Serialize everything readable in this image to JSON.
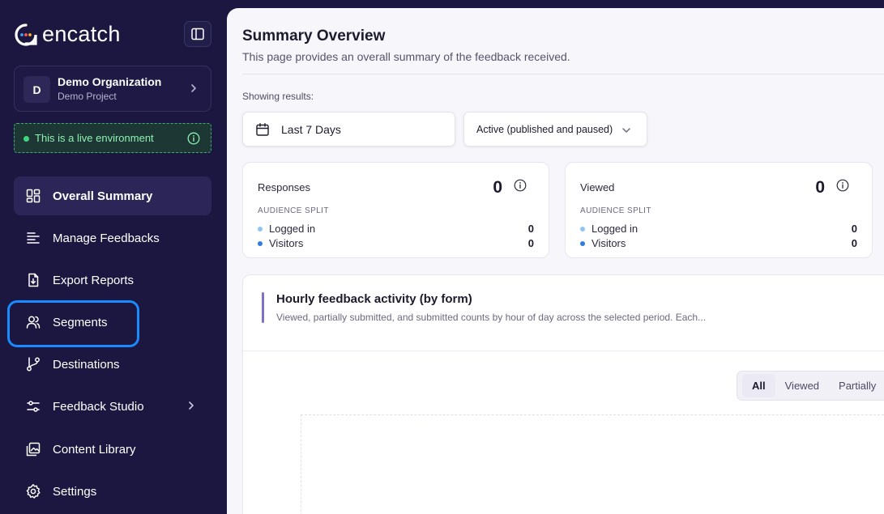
{
  "sidebar": {
    "brand": "encatch",
    "org": {
      "avatar": "D",
      "name": "Demo Organization",
      "project": "Demo Project"
    },
    "live_env": "This is a live environment",
    "nav": [
      {
        "label": "Overall Summary",
        "icon": "dashboard-icon",
        "active": true
      },
      {
        "label": "Manage Feedbacks",
        "icon": "list-icon"
      },
      {
        "label": "Export Reports",
        "icon": "file-download-icon"
      },
      {
        "label": "Segments",
        "icon": "users-icon"
      },
      {
        "label": "Destinations",
        "icon": "branch-icon"
      },
      {
        "label": "Feedback Studio",
        "icon": "sliders-icon"
      },
      {
        "label": "Content Library",
        "icon": "image-gallery-icon"
      },
      {
        "label": "Settings",
        "icon": "gear-icon"
      }
    ]
  },
  "main": {
    "title": "Summary Overview",
    "subtitle": "This page provides an overall summary of the feedback received.",
    "showing_label": "Showing results:",
    "date_range": "Last 7 Days",
    "status_filter": "Active (published and paused)",
    "cards": [
      {
        "title": "Responses",
        "value": "0",
        "split_label": "AUDIENCE SPLIT",
        "rows": [
          {
            "label": "Logged in",
            "value": "0",
            "color": "#8ec5f2"
          },
          {
            "label": "Visitors",
            "value": "0",
            "color": "#2f7de1"
          }
        ]
      },
      {
        "title": "Viewed",
        "value": "0",
        "split_label": "AUDIENCE SPLIT",
        "rows": [
          {
            "label": "Logged in",
            "value": "0",
            "color": "#8ec5f2"
          },
          {
            "label": "Visitors",
            "value": "0",
            "color": "#2f7de1"
          }
        ]
      }
    ],
    "activity": {
      "title": "Hourly feedback activity (by form)",
      "subtitle": "Viewed, partially submitted, and submitted counts by hour of day across the selected period. Each...",
      "tabs": [
        "All",
        "Viewed",
        "Partially"
      ]
    }
  },
  "colors": {
    "sidebar_bg": "#1b1740",
    "live_green": "#41d37e",
    "highlight": "#1a8bff"
  }
}
